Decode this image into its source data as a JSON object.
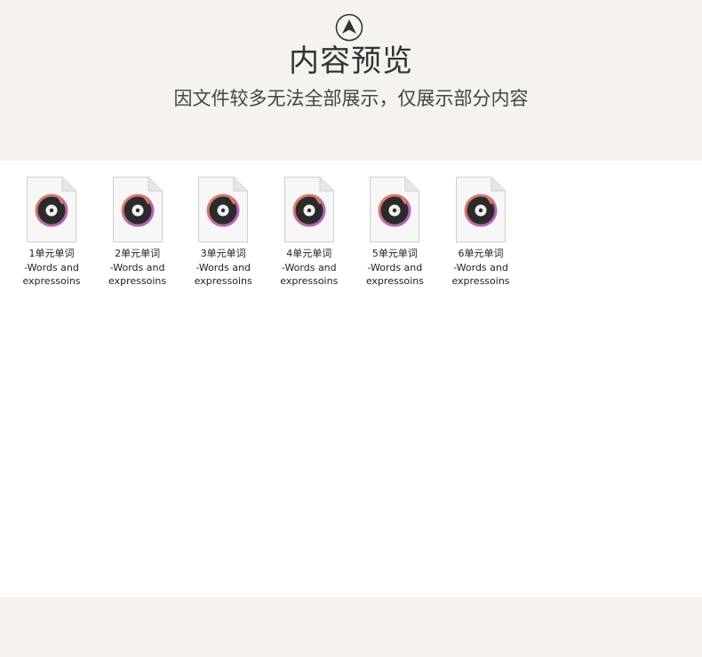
{
  "header": {
    "icon": "chevron-up-circle-icon",
    "title": "内容预览",
    "subtitle": "因文件较多无法全部展示，仅展示部分内容"
  },
  "files": [
    {
      "line1": "1单元单词",
      "line2": "-Words and",
      "line3": "expressoins",
      "icon": "music-disc-icon"
    },
    {
      "line1": "2单元单词",
      "line2": "-Words and",
      "line3": "expressoins",
      "icon": "music-disc-icon"
    },
    {
      "line1": "3单元单词",
      "line2": "-Words and",
      "line3": "expressoins",
      "icon": "music-disc-icon"
    },
    {
      "line1": "4单元单词",
      "line2": "-Words and",
      "line3": "expressoins",
      "icon": "music-disc-icon"
    },
    {
      "line1": "5单元单词",
      "line2": "-Words and",
      "line3": "expressoins",
      "icon": "music-disc-icon"
    },
    {
      "line1": "6单元单词",
      "line2": "-Words and",
      "line3": "expressoins",
      "icon": "music-disc-icon"
    }
  ],
  "colors": {
    "background": "#f6f3ee",
    "content_background": "#ffffff",
    "disc_outer_start": "#e8834a",
    "disc_outer_end": "#a45bd6",
    "disc_body": "#2b2b2b"
  }
}
